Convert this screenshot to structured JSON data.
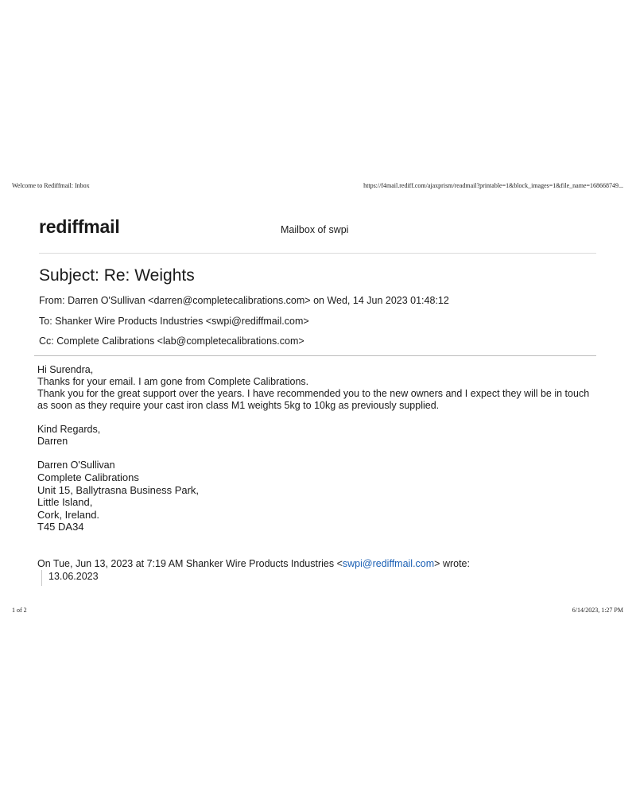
{
  "print_header": {
    "left": "Welcome to Rediffmail: Inbox",
    "right": "https://f4mail.rediff.com/ajaxprism/readmail?printable=1&block_images=1&file_name=168668749..."
  },
  "mail_header": {
    "logo": "rediffmail",
    "mailbox_title": "Mailbox of swpi"
  },
  "email": {
    "subject": "Subject: Re: Weights",
    "from": "From: Darren O'Sullivan <darren@completecalibrations.com> on Wed, 14 Jun 2023 01:48:12",
    "to": "To: Shanker Wire Products Industries <swpi@rediffmail.com>",
    "cc": "Cc: Complete Calibrations <lab@completecalibrations.com>",
    "body": {
      "greeting": "Hi Surendra,",
      "line1": "Thanks for your email. I am gone from Complete Calibrations.",
      "line2": "Thank you for the great support over the years. I have recommended you to the new owners and I expect they will be in touch as soon as they require your cast iron class M1 weights 5kg to 10kg as previously supplied.",
      "closing": "Kind Regards,",
      "closing_name": "Darren",
      "signature": {
        "name": "Darren O'Sullivan",
        "company": "Complete Calibrations",
        "address1": "Unit 15, Ballytrasna Business Park,",
        "address2": "Little Island,",
        "address3": "Cork, Ireland.",
        "postcode": "T45 DA34"
      }
    },
    "quote": {
      "intro_prefix": "On Tue, Jun 13, 2023 at 7:19 AM Shanker Wire Products Industries <",
      "intro_link": "swpi@rediffmail.com",
      "intro_suffix": "> wrote:",
      "text": "13.06.2023"
    }
  },
  "print_footer": {
    "left": "1 of 2",
    "right": "6/14/2023, 1:27 PM"
  },
  "colors": {
    "link": "#1a5fb4",
    "divider": "#bdbdbd"
  }
}
